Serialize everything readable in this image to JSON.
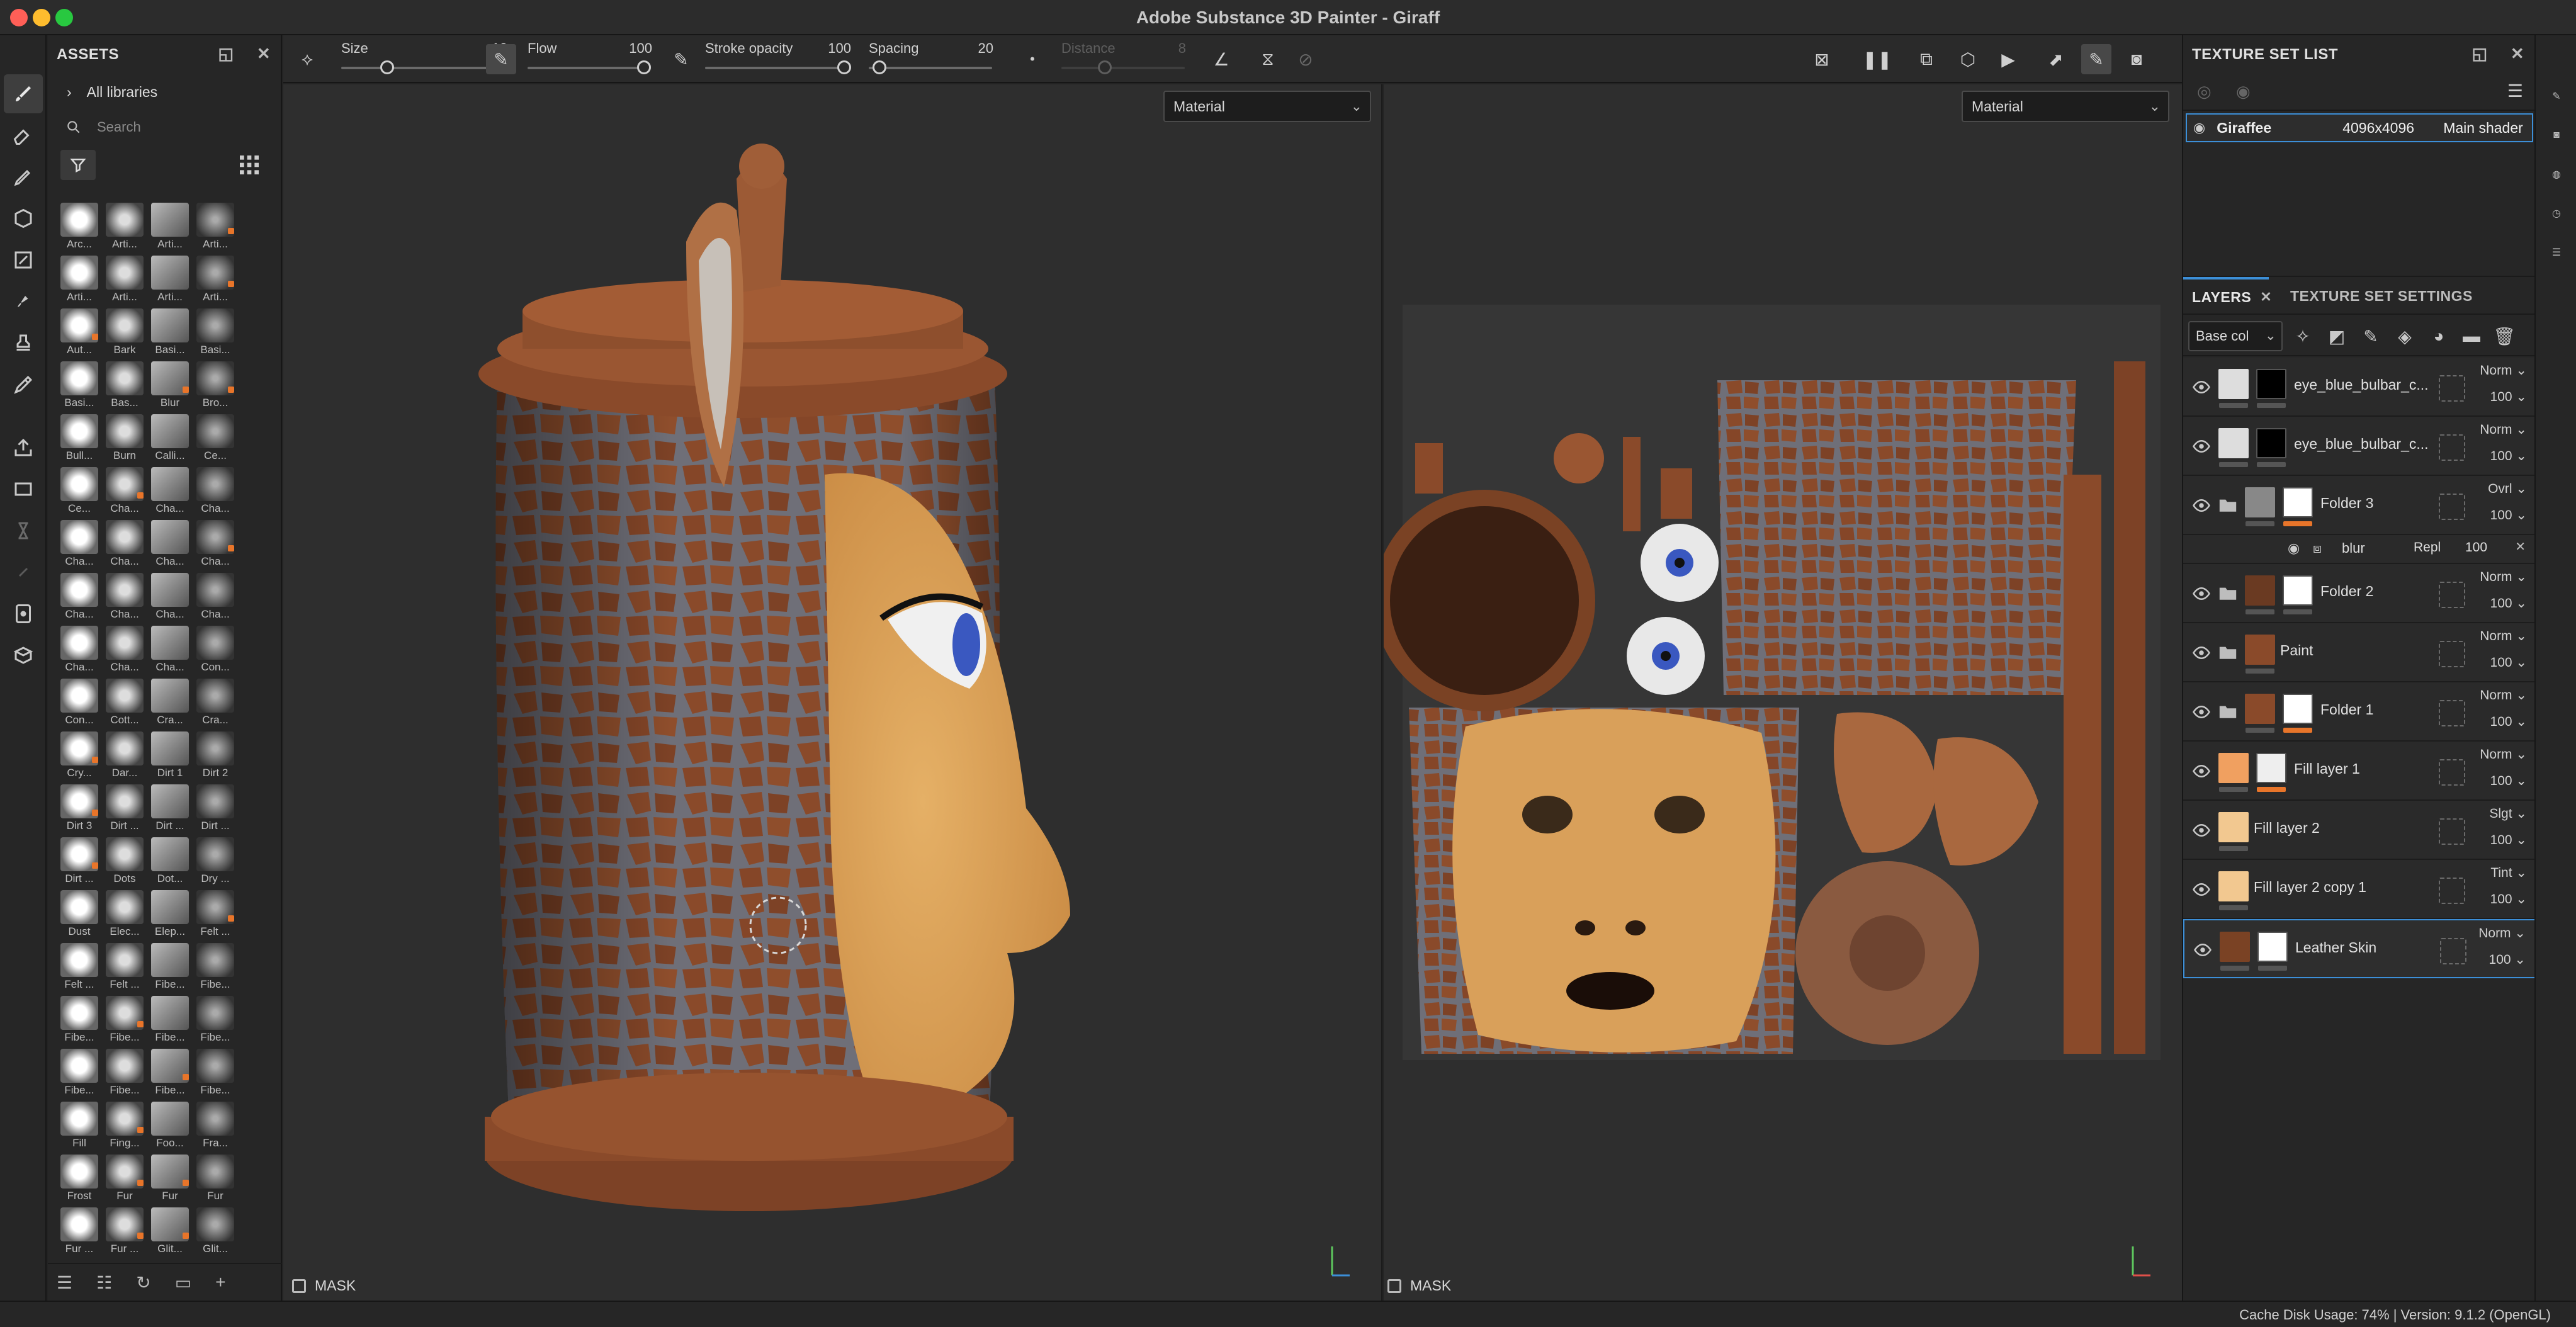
{
  "window": {
    "title": "Adobe Substance 3D Painter - Giraff"
  },
  "assets": {
    "title": "ASSETS",
    "library": "All libraries",
    "search_placeholder": "Search",
    "brushes": [
      "Arc...",
      "Arti...",
      "Arti...",
      "Arti...",
      "Arti...",
      "Arti...",
      "Arti...",
      "Arti...",
      "Aut...",
      "Bark",
      "Basi...",
      "Basi...",
      "Basi...",
      "Bas...",
      "Blur",
      "Bro...",
      "Bull...",
      "Burn",
      "Calli...",
      "Ce...",
      "Ce...",
      "Cha...",
      "Cha...",
      "Cha...",
      "Cha...",
      "Cha...",
      "Cha...",
      "Cha...",
      "Cha...",
      "Cha...",
      "Cha...",
      "Cha...",
      "Cha...",
      "Cha...",
      "Cha...",
      "Con...",
      "Con...",
      "Cott...",
      "Cra...",
      "Cra...",
      "Cry...",
      "Dar...",
      "Dirt 1",
      "Dirt 2",
      "Dirt 3",
      "Dirt ...",
      "Dirt ...",
      "Dirt ...",
      "Dirt ...",
      "Dots",
      "Dot...",
      "Dry ...",
      "Dust",
      "Elec...",
      "Elep...",
      "Felt ...",
      "Felt ...",
      "Felt ...",
      "Fibe...",
      "Fibe...",
      "Fibe...",
      "Fibe...",
      "Fibe...",
      "Fibe...",
      "Fibe...",
      "Fibe...",
      "Fibe...",
      "Fibe...",
      "Fill",
      "Fing...",
      "Foo...",
      "Fra...",
      "Frost",
      "Fur",
      "Fur",
      "Fur",
      "Fur ...",
      "Fur ...",
      "Glit...",
      "Glit..."
    ]
  },
  "toolbar": {
    "size_label": "Size",
    "size_value": "10",
    "flow_label": "Flow",
    "flow_value": "100",
    "opacity_label": "Stroke opacity",
    "opacity_value": "100",
    "spacing_label": "Spacing",
    "spacing_value": "20",
    "distance_label": "Distance",
    "distance_value": "8"
  },
  "viewport3d": {
    "mode": "Material",
    "mask_label": "MASK"
  },
  "viewport2d": {
    "mode": "Material",
    "mask_label": "MASK"
  },
  "texture_set_list": {
    "title": "TEXTURE SET LIST",
    "row": {
      "name": "Giraffee",
      "resolution": "4096x4096",
      "shader": "Main shader"
    }
  },
  "layers_panel": {
    "tab_layers": "LAYERS",
    "tab_settings": "TEXTURE SET SETTINGS",
    "channel": "Base col",
    "layers": [
      {
        "name": "eye_blue_bulbar_c...",
        "blend": "Norm",
        "opacity": "100"
      },
      {
        "name": "eye_blue_bulbar_c...",
        "blend": "Norm",
        "opacity": "100"
      },
      {
        "name": "Folder 3",
        "blend": "Ovrl",
        "opacity": "100"
      },
      {
        "name": "blur",
        "blend": "Repl",
        "opacity": "100"
      },
      {
        "name": "Folder 2",
        "blend": "Norm",
        "opacity": "100"
      },
      {
        "name": "Paint",
        "blend": "Norm",
        "opacity": "100"
      },
      {
        "name": "Folder 1",
        "blend": "Norm",
        "opacity": "100"
      },
      {
        "name": "Fill layer 1",
        "blend": "Norm",
        "opacity": "100"
      },
      {
        "name": "Fill layer 2",
        "blend": "Slgt",
        "opacity": "100"
      },
      {
        "name": "Fill layer 2 copy 1",
        "blend": "Tint",
        "opacity": "100"
      },
      {
        "name": "Leather Skin",
        "blend": "Norm",
        "opacity": "100"
      }
    ]
  },
  "status": {
    "text": "Cache Disk Usage:     74% | Version: 9.1.2 (OpenGL)"
  },
  "colors": {
    "accent": "#3c8fd8",
    "badge": "#e8752a",
    "leather": "#8a4a2a",
    "skin": "#d9a05a"
  }
}
